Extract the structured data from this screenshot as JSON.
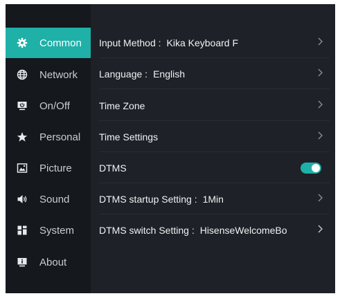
{
  "sidebar": {
    "items": [
      {
        "label": "Common",
        "icon": "gear-icon",
        "active": true
      },
      {
        "label": "Network",
        "icon": "globe-icon",
        "active": false
      },
      {
        "label": "On/Off",
        "icon": "power-monitor-icon",
        "active": false
      },
      {
        "label": "Personal",
        "icon": "star-icon",
        "active": false
      },
      {
        "label": "Picture",
        "icon": "picture-icon",
        "active": false
      },
      {
        "label": "Sound",
        "icon": "speaker-icon",
        "active": false
      },
      {
        "label": "System",
        "icon": "system-grid-icon",
        "active": false
      },
      {
        "label": "About",
        "icon": "info-monitor-icon",
        "active": false
      }
    ]
  },
  "settings": {
    "rows": [
      {
        "label": "Input Method :",
        "value": "Kika Keyboard F",
        "control": "chevron"
      },
      {
        "label": "Language :",
        "value": "English",
        "control": "chevron"
      },
      {
        "label": "Time Zone",
        "value": "",
        "control": "chevron"
      },
      {
        "label": "Time Settings",
        "value": "",
        "control": "chevron"
      },
      {
        "label": "DTMS",
        "value": "",
        "control": "toggle",
        "on": true
      },
      {
        "label": "DTMS startup Setting :",
        "value": "1Min",
        "control": "chevron"
      },
      {
        "label": "DTMS switch Setting :",
        "value": "HisenseWelcomeBo",
        "control": "chevron"
      }
    ]
  },
  "colors": {
    "accent": "#1fb0a8",
    "sidebar_bg": "#15181d",
    "main_bg": "#1e2127"
  }
}
